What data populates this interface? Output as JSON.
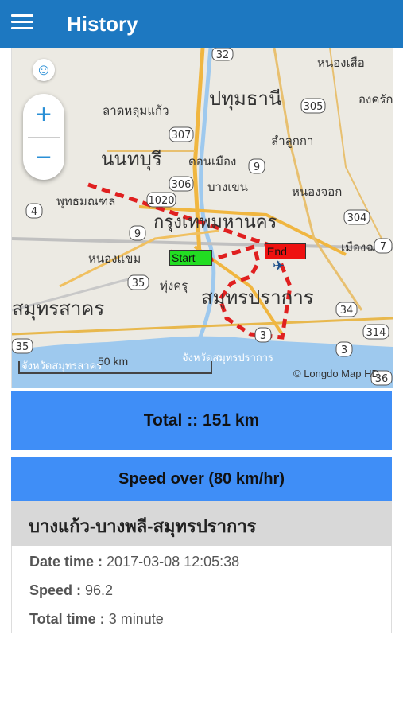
{
  "header": {
    "title": "History",
    "menu_icon": "hamburger-menu-icon",
    "background_color": "#1d78c1"
  },
  "map": {
    "zoom_in_label": "+",
    "zoom_out_label": "−",
    "accessibility_icon": "accessibility-icon",
    "start_label": "Start",
    "end_label": "End",
    "scale_label": "50 km",
    "credit": "© Longdo Map HD",
    "route_color": "#e02020",
    "place_labels": [
      {
        "text": "ปทุมธานี"
      },
      {
        "text": "นนทบุรี"
      },
      {
        "text": "กรุงเทพมหานคร"
      },
      {
        "text": "สมุทรปราการ"
      },
      {
        "text": "สมุทรสาคร"
      },
      {
        "text": "ลาดหลุมแก้ว"
      },
      {
        "text": "หนองเสือ"
      },
      {
        "text": "องครักษ์"
      },
      {
        "text": "ลำลูกกา"
      },
      {
        "text": "ดอนเมือง"
      },
      {
        "text": "บางเขน"
      },
      {
        "text": "หนองจอก"
      },
      {
        "text": "พุทธมณฑล"
      },
      {
        "text": "หนองแขม"
      },
      {
        "text": "ทุ่งครุ"
      },
      {
        "text": "เมืองฉะเชิง"
      },
      {
        "text": "จังหวัดสมุทรสาคร"
      },
      {
        "text": "จังหวัดสมุทรปราการ"
      }
    ],
    "road_shields": [
      "32",
      "305",
      "307",
      "9",
      "306",
      "1020",
      "4",
      "9",
      "35",
      "304",
      "34",
      "314",
      "3",
      "3",
      "35",
      "36",
      "7"
    ]
  },
  "summary": {
    "total_label": "Total :: 151 km",
    "speed_over_label": "Speed over (80 km/hr)"
  },
  "record": {
    "route_name": "บางแก้ว-บางพลี-สมุทรปราการ",
    "date_time_label": "Date time :",
    "date_time_value": "2017-03-08 12:05:38",
    "speed_label": "Speed :",
    "speed_value": "96.2",
    "total_time_label": "Total time :",
    "total_time_value": "3 minute"
  },
  "colors": {
    "card_blue": "#3f8ef7",
    "route_header_gray": "#d8d8d8",
    "start_marker": "#22dd22",
    "end_marker": "#ee1111"
  }
}
